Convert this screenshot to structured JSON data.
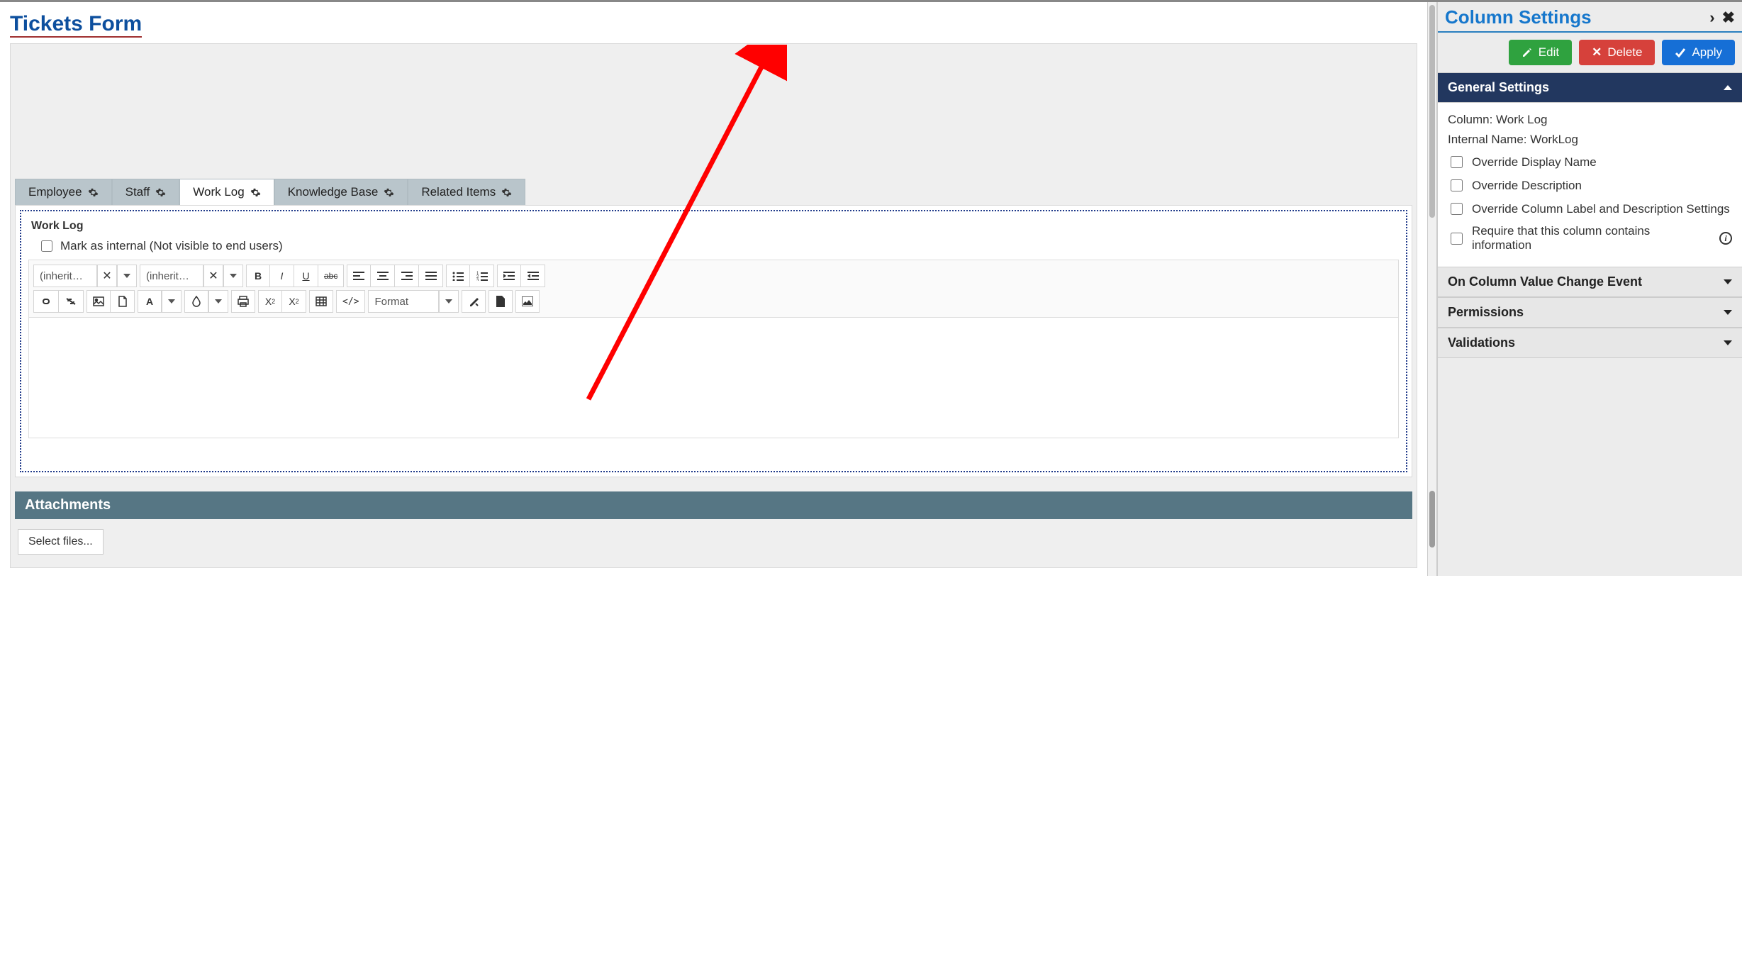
{
  "page": {
    "title": "Tickets Form"
  },
  "tabs": [
    {
      "label": "Employee"
    },
    {
      "label": "Staff"
    },
    {
      "label": "Work Log"
    },
    {
      "label": "Knowledge Base"
    },
    {
      "label": "Related Items"
    }
  ],
  "active_tab_index": 2,
  "work_log": {
    "field_label": "Work Log",
    "mark_internal_label": "Mark as internal (Not visible to end users)",
    "font_family_display": "(inherit…",
    "font_size_display": "(inherit…",
    "format_label": "Format"
  },
  "attachments": {
    "header": "Attachments",
    "select_files_label": "Select files..."
  },
  "side": {
    "title": "Column Settings",
    "buttons": {
      "edit": "Edit",
      "delete": "Delete",
      "apply": "Apply"
    },
    "general": {
      "header": "General Settings",
      "column_label": "Column:",
      "column_value": "Work Log",
      "internal_label": "Internal Name:",
      "internal_value": "WorkLog",
      "opts": {
        "override_display": "Override Display Name",
        "override_desc": "Override Description",
        "override_label_desc": "Override Column Label and Description Settings",
        "require_info": "Require that this column contains information"
      }
    },
    "sections": {
      "on_change": "On Column Value Change Event",
      "permissions": "Permissions",
      "validations": "Validations"
    }
  }
}
